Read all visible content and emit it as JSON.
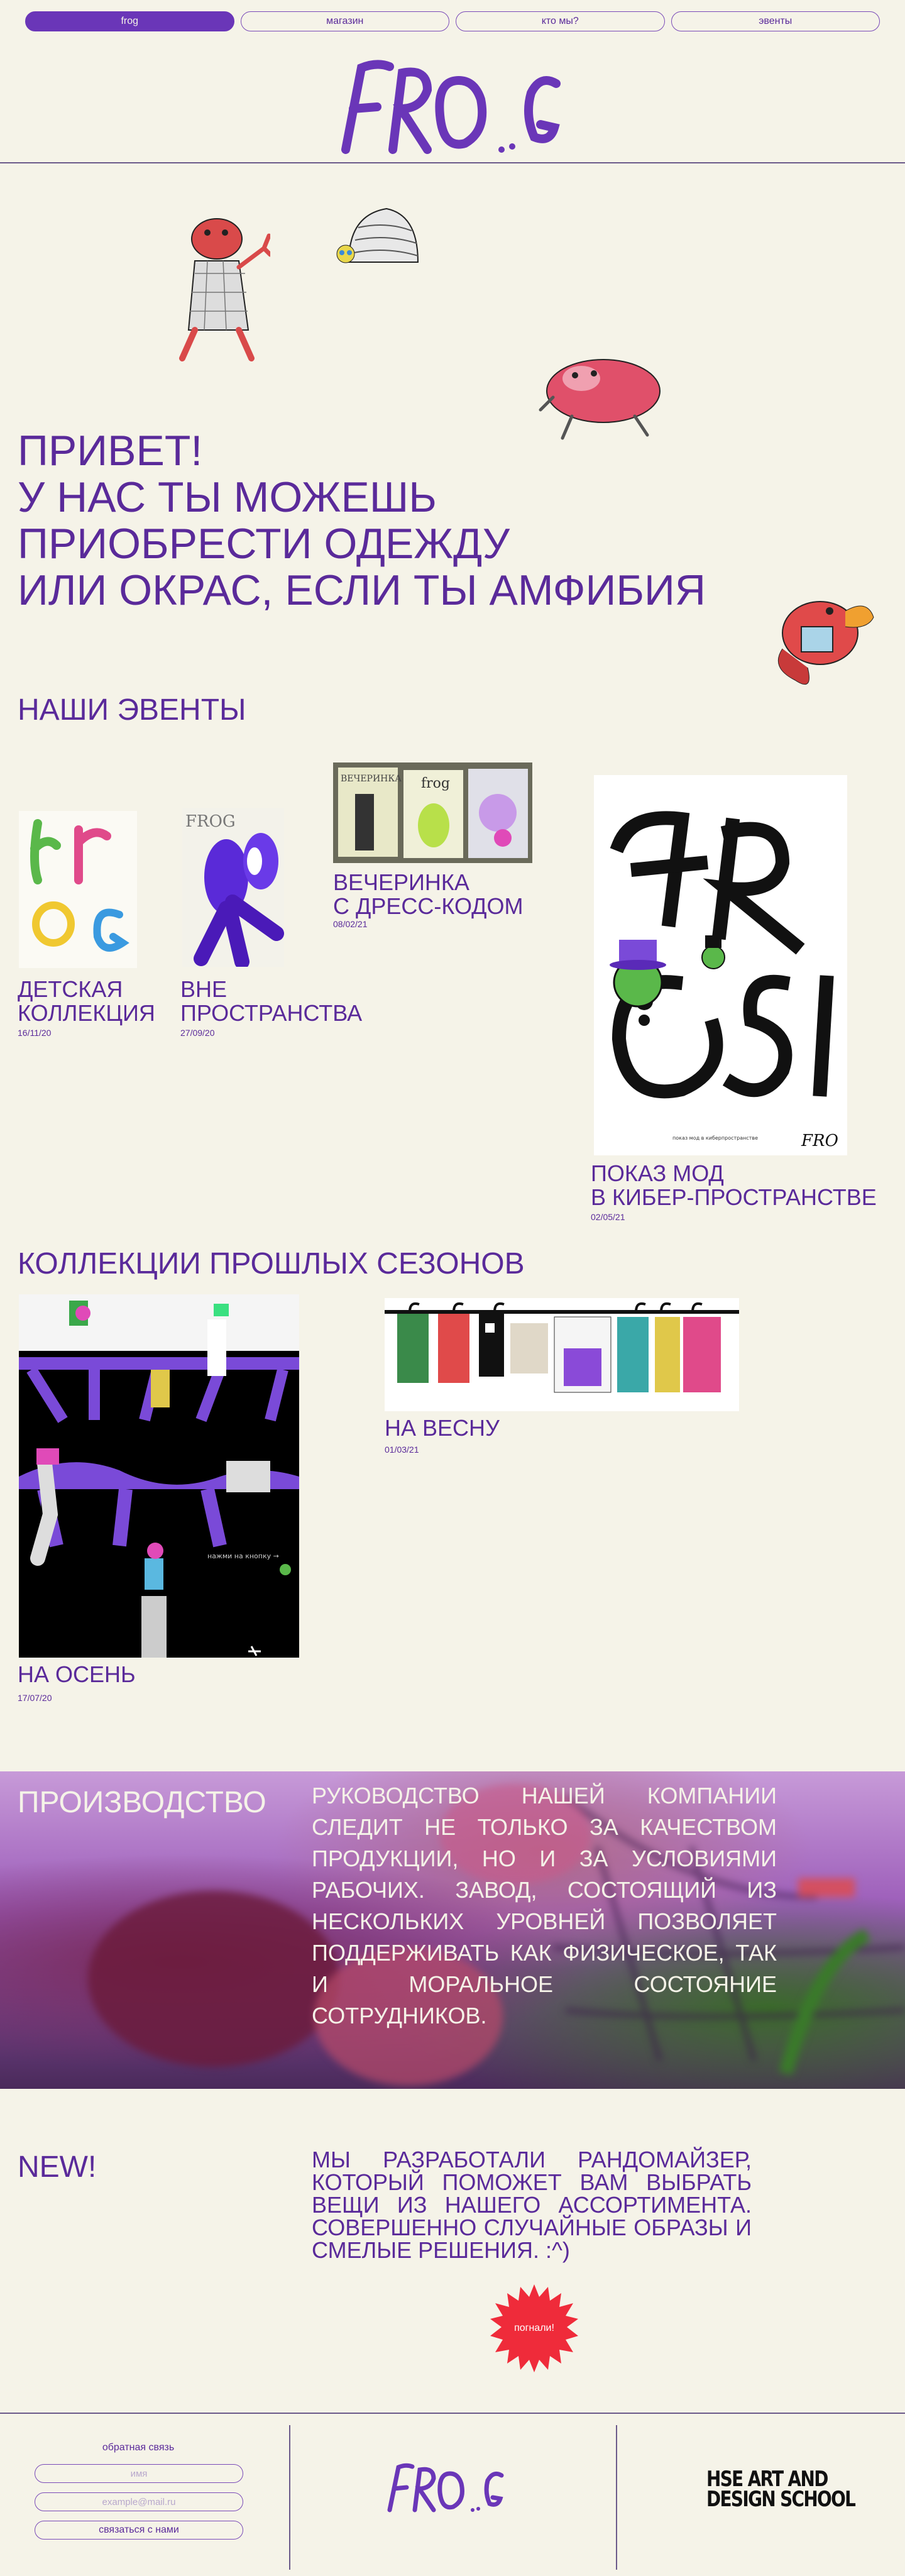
{
  "nav": {
    "items": [
      {
        "label": "frog",
        "active": true
      },
      {
        "label": "магазин"
      },
      {
        "label": "кто мы?"
      },
      {
        "label": "эвенты"
      }
    ]
  },
  "logo": {
    "text": "FRO..G"
  },
  "hero": {
    "line1": "ПРИВЕТ!",
    "line2": "У НАС ТЫ МОЖЕШЬ",
    "line3": "ПРИОБРЕСТИ ОДЕЖДУ",
    "line4": "ИЛИ ОКРАС, ЕСЛИ ТЫ АМФИБИЯ"
  },
  "events": {
    "title": "НАШИ ЭВЕНТЫ",
    "items": [
      {
        "title_l1": "ДЕТСКАЯ",
        "title_l2": "КОЛЛЕКЦИЯ",
        "date": "16/11/20"
      },
      {
        "title_l1": "ВНЕ",
        "title_l2": "ПРОСТРАНСТВА",
        "date": "27/09/20"
      },
      {
        "title_l1": "ВЕЧЕРИНКА",
        "title_l2": "С ДРЕСС-КОДОМ",
        "date": "08/02/21"
      },
      {
        "title_l1": "ПОКАЗ МОД",
        "title_l2": "В КИБЕР-ПРОСТРАНСТВЕ",
        "date": "02/05/21"
      }
    ]
  },
  "collections": {
    "title": "КОЛЛЕКЦИИ ПРОШЛЫХ СЕЗОНОВ",
    "items": [
      {
        "title": "НА ОСЕНЬ",
        "date": "17/07/20",
        "screen_text": "нажми на кнопку →"
      },
      {
        "title": "НА ВЕСНУ",
        "date": "01/03/21"
      }
    ]
  },
  "production": {
    "title": "ПРОИЗВОДСТВО",
    "text": "РУКОВОДСТВО НАШЕЙ КОМПАНИИ СЛЕДИТ НЕ ТОЛЬКО ЗА КАЧЕСТВОМ ПРОДУКЦИИ, НО И ЗА УСЛОВИЯМИ РАБОЧИХ. ЗАВОД, СОСТОЯЩИЙ ИЗ НЕСКОЛЬКИХ УРОВНЕЙ ПОЗВОЛЯЕТ ПОДДЕРЖИВАТЬ КАК ФИЗИЧЕСКОЕ, ТАК И МОРАЛЬНОЕ СОСТОЯНИЕ СОТРУДНИКОВ."
  },
  "new_section": {
    "title": "NEW!",
    "text": "МЫ РАЗРАБОТАЛИ РАНДОМАЙЗЕР, КОТОРЫЙ ПОМОЖЕТ ВАМ ВЫБРАТЬ ВЕЩИ ИЗ НАШЕГО АССОРТИМЕНТА. СОВЕРШЕННО СЛУЧАЙНЫЕ ОБРАЗЫ И СМЕЛЫЕ РЕШЕНИЯ. :^)",
    "button": "погнали!"
  },
  "footer": {
    "feedback_label": "обратная связь",
    "name_placeholder": "имя",
    "email_placeholder": "example@mail.ru",
    "submit": "связаться с нами",
    "logo": "FRO..G",
    "hse_line1": "HSE ART AND",
    "hse_line2": "DESIGN SCHOOL"
  },
  "colors": {
    "accent": "#6a36b8",
    "text": "#5a2a9a",
    "background": "#f5f3e8",
    "burst": "#ef2b3a"
  }
}
